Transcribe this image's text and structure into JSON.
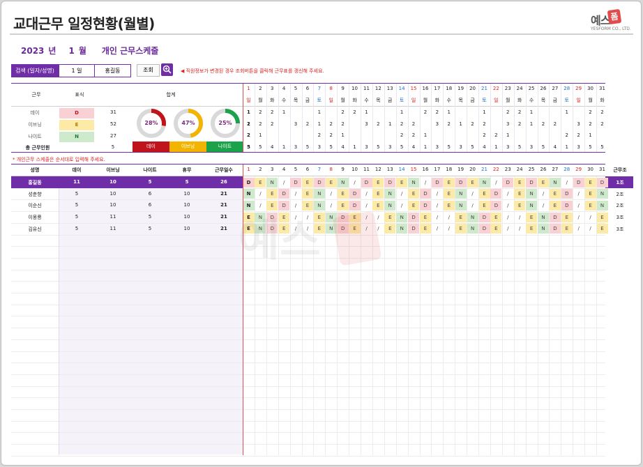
{
  "title": "교대근무 일정현황(월별)",
  "logo": {
    "text": "예스",
    "box": "폼",
    "company": "YESFORM CO., LTD."
  },
  "heading": {
    "year": "2023",
    "year_unit": "년",
    "month": "1",
    "month_unit": "월",
    "subtitle": "개인 근무스케줄"
  },
  "search": {
    "label": "검색 (일자/성명)",
    "day_value": "1 일",
    "name_value": "홍길동",
    "query_button": "조회"
  },
  "notice": "◀ 직원정보가 변경된 경우 조회버튼을 클릭해 근무표를 갱신해 주세요.",
  "summary": {
    "headers": {
      "shift": "근무",
      "mark": "표식",
      "total": "합계"
    },
    "rows": [
      {
        "name": "데이",
        "mark": "D",
        "count": "31",
        "color": "#f9d0d3"
      },
      {
        "name": "이브닝",
        "mark": "E",
        "count": "52",
        "color": "#fdeaa6"
      },
      {
        "name": "나이트",
        "mark": "N",
        "count": "27",
        "color": "#cfe9cc"
      }
    ],
    "total_label": "총 근무인원",
    "total_value": "5",
    "donuts": [
      {
        "pct": 28,
        "label": "28%",
        "color": "#c0131b",
        "name": "데이"
      },
      {
        "pct": 47,
        "label": "47%",
        "color": "#f3b400",
        "name": "이브닝"
      },
      {
        "pct": 25,
        "label": "25%",
        "color": "#1aa34a",
        "name": "나이트"
      }
    ],
    "day_marks": [
      "D",
      "E",
      "N",
      "D",
      "E",
      "N",
      "D",
      "E",
      "N",
      "D",
      "E",
      "N",
      "D",
      "E",
      "N",
      "D",
      "E",
      "N",
      "D",
      "E",
      "N",
      "D",
      "E",
      "N",
      "D",
      "E",
      "N",
      "D",
      "E",
      "N",
      "D"
    ],
    "shift_row_labels": [
      "1",
      "2",
      "2",
      "5"
    ],
    "daily": {
      "day": [
        "",
        "2",
        "2",
        "1",
        "",
        "",
        "1",
        "",
        "2",
        "2",
        "1",
        "",
        "",
        "1",
        "",
        "2",
        "2",
        "1",
        "",
        "",
        "1",
        "",
        "2",
        "2",
        "1",
        "",
        "",
        "1",
        "",
        "2",
        "2",
        "1"
      ],
      "eve": [
        "1",
        "2",
        "2",
        "",
        "3",
        "2",
        "1",
        "2",
        "2",
        "",
        "3",
        "2",
        "1",
        "2",
        "2",
        "",
        "3",
        "2",
        "1",
        "2",
        "2",
        "",
        "3",
        "2",
        "1",
        "2",
        "2",
        "",
        "3",
        "2",
        "2"
      ],
      "night": [
        "2",
        "1",
        "",
        "",
        "",
        "",
        "2",
        "2",
        "1",
        "",
        "",
        "",
        "",
        "2",
        "2",
        "1",
        "",
        "",
        "",
        "",
        "2",
        "2",
        "1",
        "",
        "",
        "",
        "",
        "2",
        "2",
        "1",
        ""
      ],
      "total": [
        "3",
        "5",
        "4",
        "1",
        "3",
        "5",
        "3",
        "5",
        "4",
        "1",
        "3",
        "5",
        "3",
        "5",
        "4",
        "1",
        "3",
        "5",
        "3",
        "5",
        "4",
        "1",
        "3",
        "5",
        "3",
        "5",
        "4",
        "1",
        "3",
        "5",
        "5"
      ]
    }
  },
  "days": [
    "1",
    "2",
    "3",
    "4",
    "5",
    "6",
    "7",
    "8",
    "9",
    "10",
    "11",
    "12",
    "13",
    "14",
    "15",
    "16",
    "17",
    "18",
    "19",
    "20",
    "21",
    "22",
    "23",
    "24",
    "25",
    "26",
    "27",
    "28",
    "29",
    "30",
    "31"
  ],
  "weekdays": [
    "일",
    "월",
    "화",
    "수",
    "목",
    "금",
    "토",
    "일",
    "월",
    "화",
    "수",
    "목",
    "금",
    "토",
    "일",
    "월",
    "화",
    "수",
    "목",
    "금",
    "토",
    "일",
    "월",
    "화",
    "수",
    "목",
    "금",
    "토",
    "일",
    "월",
    "화"
  ],
  "note": "* 개인근무 스케줄은 순서대로 입력해 주세요.",
  "main": {
    "headers": {
      "name": "성명",
      "day": "데이",
      "eve": "이브닝",
      "night": "나이트",
      "off": "휴무",
      "work_days": "근무일수",
      "group": "근무조"
    },
    "employees": [
      {
        "name": "홍길동",
        "day": "11",
        "eve": "10",
        "night": "5",
        "off": "5",
        "work": "26",
        "group": "1조",
        "schedule": [
          "D",
          "E",
          "N",
          "/",
          "D",
          "E",
          "D",
          "E",
          "N",
          "/",
          "D",
          "E",
          "D",
          "E",
          "N",
          "/",
          "D",
          "E",
          "D",
          "E",
          "N",
          "/",
          "D",
          "E",
          "D",
          "E",
          "N",
          "/",
          "D",
          "E",
          "D"
        ],
        "highlight": true
      },
      {
        "name": "성춘향",
        "day": "5",
        "eve": "10",
        "night": "6",
        "off": "10",
        "work": "21",
        "group": "2조",
        "schedule": [
          "N",
          "/",
          "E",
          "D",
          "/",
          "E",
          "N",
          "/",
          "E",
          "D",
          "/",
          "E",
          "N",
          "/",
          "E",
          "D",
          "/",
          "E",
          "N",
          "/",
          "E",
          "D",
          "/",
          "E",
          "N",
          "/",
          "E",
          "D",
          "/",
          "E",
          "N"
        ]
      },
      {
        "name": "이순신",
        "day": "5",
        "eve": "10",
        "night": "6",
        "off": "10",
        "work": "21",
        "group": "2조",
        "schedule": [
          "N",
          "/",
          "E",
          "D",
          "/",
          "E",
          "N",
          "/",
          "E",
          "D",
          "/",
          "E",
          "N",
          "/",
          "E",
          "D",
          "/",
          "E",
          "N",
          "/",
          "E",
          "D",
          "/",
          "E",
          "N",
          "/",
          "E",
          "D",
          "/",
          "E",
          "N"
        ]
      },
      {
        "name": "이몽룡",
        "day": "5",
        "eve": "11",
        "night": "5",
        "off": "10",
        "work": "21",
        "group": "3조",
        "schedule": [
          "E",
          "N",
          "D",
          "E",
          "/",
          "/",
          "E",
          "N",
          "D",
          "E",
          "/",
          "/",
          "E",
          "N",
          "D",
          "E",
          "/",
          "/",
          "E",
          "N",
          "D",
          "E",
          "/",
          "/",
          "E",
          "N",
          "D",
          "E",
          "/",
          "/",
          "E"
        ]
      },
      {
        "name": "김유신",
        "day": "5",
        "eve": "11",
        "night": "5",
        "off": "10",
        "work": "21",
        "group": "3조",
        "schedule": [
          "E",
          "N",
          "D",
          "E",
          "/",
          "/",
          "E",
          "N",
          "D",
          "E",
          "/",
          "/",
          "E",
          "N",
          "D",
          "E",
          "/",
          "/",
          "E",
          "N",
          "D",
          "E",
          "/",
          "/",
          "E",
          "N",
          "D",
          "E",
          "/",
          "/",
          "E"
        ]
      }
    ]
  },
  "colors": {
    "accent": "#6f2da8",
    "day": "#f9d0d3",
    "eve": "#fdeaa6",
    "night": "#cfe9cc",
    "redline": "#e24b4b"
  }
}
